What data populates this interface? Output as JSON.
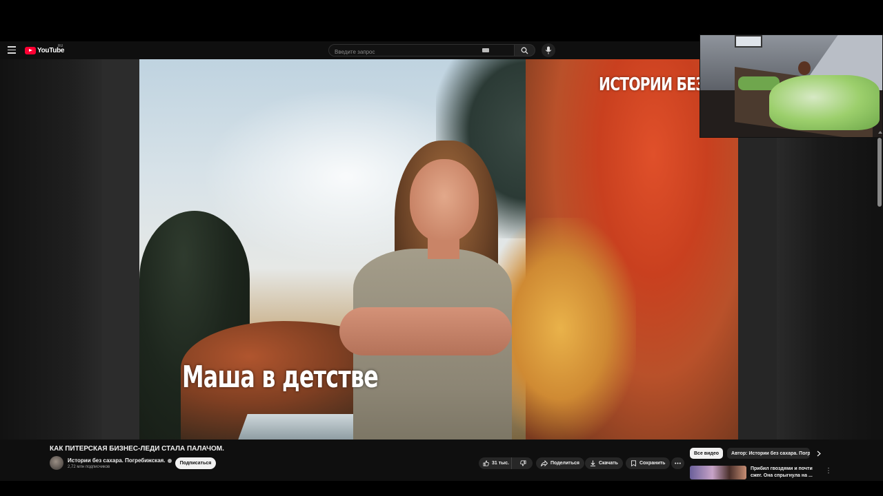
{
  "header": {
    "logo_text": "YouTube",
    "logo_region": "RU",
    "search_placeholder": "Введите запрос"
  },
  "video": {
    "overlay_title": "ИСТОРИИ БЕЗ С",
    "overlay_caption": "Маша в детстве",
    "title": "КАК ПИТЕРСКАЯ БИЗНЕС-ЛЕДИ СТАЛА ПАЛАЧОМ."
  },
  "channel": {
    "name": "Истории без сахара. Погребижская.",
    "subscribers": "2,72 млн подписчиков",
    "subscribe_label": "Подписаться"
  },
  "actions": {
    "likes": "31 тыс.",
    "share": "Поделиться",
    "download": "Скачать",
    "save": "Сохранить"
  },
  "sidebar": {
    "chips": [
      "Все видео",
      "Автор: Истории без сахара. Погреби"
    ],
    "recommendation_title": "Прибил гвоздями и почти сжег. Она спрыгнула на ..."
  },
  "icons": [
    "menu-icon",
    "keyboard-icon",
    "search-icon",
    "mic-icon",
    "like-icon",
    "dislike-icon",
    "share-icon",
    "download-icon",
    "save-icon",
    "more-icon",
    "chevron-right-icon",
    "more-vert-icon"
  ]
}
